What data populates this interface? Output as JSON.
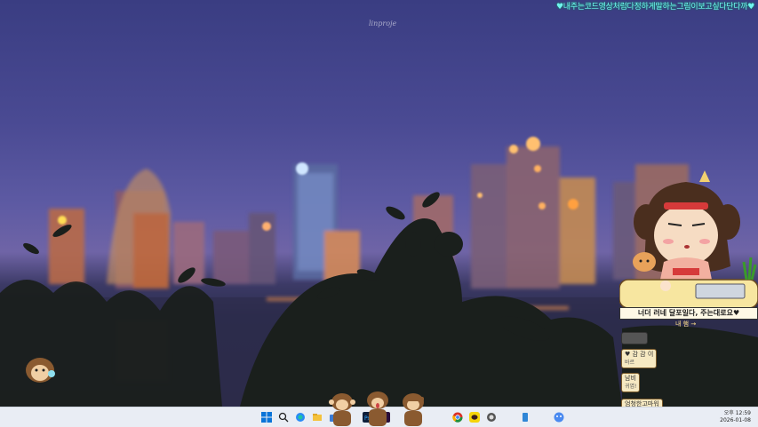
{
  "marquee_text": "♥내주는코드영상처럼다정하게말하는그림이보고싶다단다까♥",
  "watermark": "linproje",
  "widget": {
    "speech": "너더 러네 달포일다, 주는대로요♥",
    "speech_sub": "내 햄 →",
    "messages": [
      {
        "name": "",
        "text": ""
      },
      {
        "name": "♥ 감 감 이",
        "text": "바르"
      },
      {
        "name": "남비",
        "text": "귀엽!"
      },
      {
        "name": "엄청한고마워",
        "text": ""
      }
    ]
  },
  "taskbar": {
    "icons": [
      "windows-start-icon",
      "search-icon",
      "copilot-icon",
      "edge-icon",
      "file-explorer-icon",
      "store-icon",
      "app-icon",
      "photoshop-icon",
      "premiere-icon",
      "game-icon",
      "kakaotalk-icon",
      "chrome-icon",
      "app-icon",
      "app-icon",
      "app-icon",
      "phone-link-icon",
      "app-icon"
    ],
    "clock_time": "오후 12:59",
    "clock_date": "2026-01-08"
  },
  "colors": {
    "accent_text": "#6ff4ef",
    "taskbar": "#e9edf4"
  }
}
